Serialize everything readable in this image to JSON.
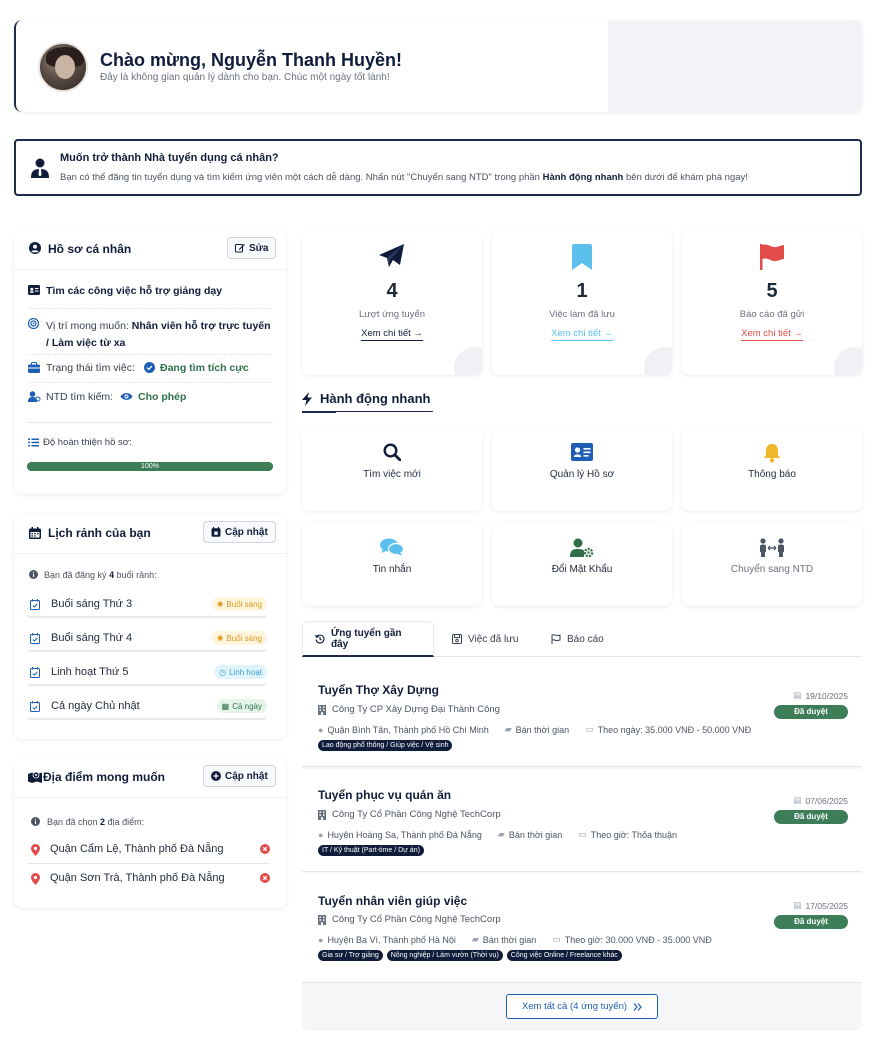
{
  "welcome": {
    "title": "Chào mừng, Nguyễn Thanh Huyền!",
    "subtitle": "Đây là không gian quản lý dành cho bạn. Chúc một ngày tốt lành!"
  },
  "banner": {
    "title": "Muốn trở thành Nhà tuyển dụng cá nhân?",
    "text_before": "Bạn có thể đăng tin tuyển dụng và tìm kiếm ứng viên một cách dễ dàng. Nhấn nút \"Chuyển sang NTD\" trong phần ",
    "text_bold": "Hành động nhanh",
    "text_after": " bên dưới để khám phá ngay!"
  },
  "profile": {
    "title": "Hồ sơ cá nhân",
    "edit_label": "Sửa",
    "headline": "Tìm các công việc hỗ trợ giảng dạy",
    "position_label": "Vị trí mong muốn:",
    "position_value": "Nhân viên hỗ trợ trực tuyến / Làm việc từ xa",
    "status_label": "Trạng thái tìm việc:",
    "status_value": "Đang tìm tích cực",
    "search_label": "NTD tìm kiếm:",
    "search_value": "Cho phép",
    "completeness_label": "Độ hoàn thiện hồ sơ:",
    "completeness_text": "100%",
    "completeness": 100
  },
  "schedule": {
    "title": "Lịch rảnh của bạn",
    "update_label": "Cập nhật",
    "note_before": "Bạn đã đăng ký ",
    "note_count": "4",
    "note_after": " buổi rảnh:",
    "items": [
      {
        "label": "Buổi sáng Thứ 3",
        "badge": "Buổi sáng"
      },
      {
        "label": "Buổi sáng Thứ 4",
        "badge": "Buổi sáng"
      },
      {
        "label": "Linh hoạt Thứ 5",
        "badge": "Linh hoạt"
      },
      {
        "label": "Cả ngày Chủ nhật",
        "badge": "Cả ngày"
      }
    ]
  },
  "locations": {
    "title": "Địa điểm mong muốn",
    "update_label": "Cập nhật",
    "note_before": "Bạn đã chọn ",
    "note_count": "2",
    "note_after": " địa điểm:",
    "items": [
      {
        "label": "Quận Cẩm Lệ, Thành phố Đà Nẵng"
      },
      {
        "label": "Quận Sơn Trà, Thành phố Đà Nẵng"
      }
    ]
  },
  "stats": [
    {
      "value": "4",
      "label": "Lượt ứng tuyển",
      "link": "Xem chi tiết →",
      "color": "#0f1c3a"
    },
    {
      "value": "1",
      "label": "Việc làm đã lưu",
      "link": "Xem chi tiết →",
      "color": "#5bc0eb"
    },
    {
      "value": "5",
      "label": "Báo cáo đã gửi",
      "link": "Xem chi tiết →",
      "color": "#e24c4b"
    }
  ],
  "quick_actions": {
    "title": "Hành động nhanh",
    "items": [
      {
        "label": "Tìm việc mới"
      },
      {
        "label": "Quản lý Hồ sơ"
      },
      {
        "label": "Thông báo"
      },
      {
        "label": "Tin nhắn"
      },
      {
        "label": "Đổi Mật Khẩu"
      },
      {
        "label": "Chuyển sang NTD"
      }
    ]
  },
  "tabs": [
    {
      "label": "Ứng tuyển gần đây"
    },
    {
      "label": "Việc đã lưu"
    },
    {
      "label": "Báo cáo"
    }
  ],
  "jobs": [
    {
      "title": "Tuyển Thợ Xây Dựng",
      "company": "Công Ty CP Xây Dựng Đại Thành Công",
      "location": "Quận Bình Tân, Thành phố Hồ Chí Minh",
      "type": "Bán thời gian",
      "salary": "Theo ngày: 35.000 VNĐ - 50.000 VNĐ",
      "tags": [
        "Lao động phổ thông / Giúp việc / Vệ sinh"
      ],
      "date": "19/10/2025",
      "status": "Đã duyệt"
    },
    {
      "title": "Tuyển phục vụ quán ăn",
      "company": "Công Ty Cổ Phần Công Nghệ TechCorp",
      "location": "Huyện Hoàng Sa, Thành phố Đà Nẵng",
      "type": "Bán thời gian",
      "salary": "Theo giờ: Thỏa thuận",
      "tags": [
        "IT / Kỹ thuật (Part-time / Dự án)"
      ],
      "date": "07/06/2025",
      "status": "Đã duyệt"
    },
    {
      "title": "Tuyển nhân viên giúp việc",
      "company": "Công Ty Cổ Phần Công Nghệ TechCorp",
      "location": "Huyện Ba Vì, Thành phố Hà Nội",
      "type": "Bán thời gian",
      "salary": "Theo giờ: 30.000 VNĐ - 35.000 VNĐ",
      "tags": [
        "Gia sư / Trợ giảng",
        "Nông nghiệp / Làm vườn (Thời vụ)",
        "Công việc Online / Freelance khác"
      ],
      "date": "17/05/2025",
      "status": "Đã duyệt"
    }
  ],
  "view_all_label": "Xem tất cả (4 ứng tuyển)"
}
